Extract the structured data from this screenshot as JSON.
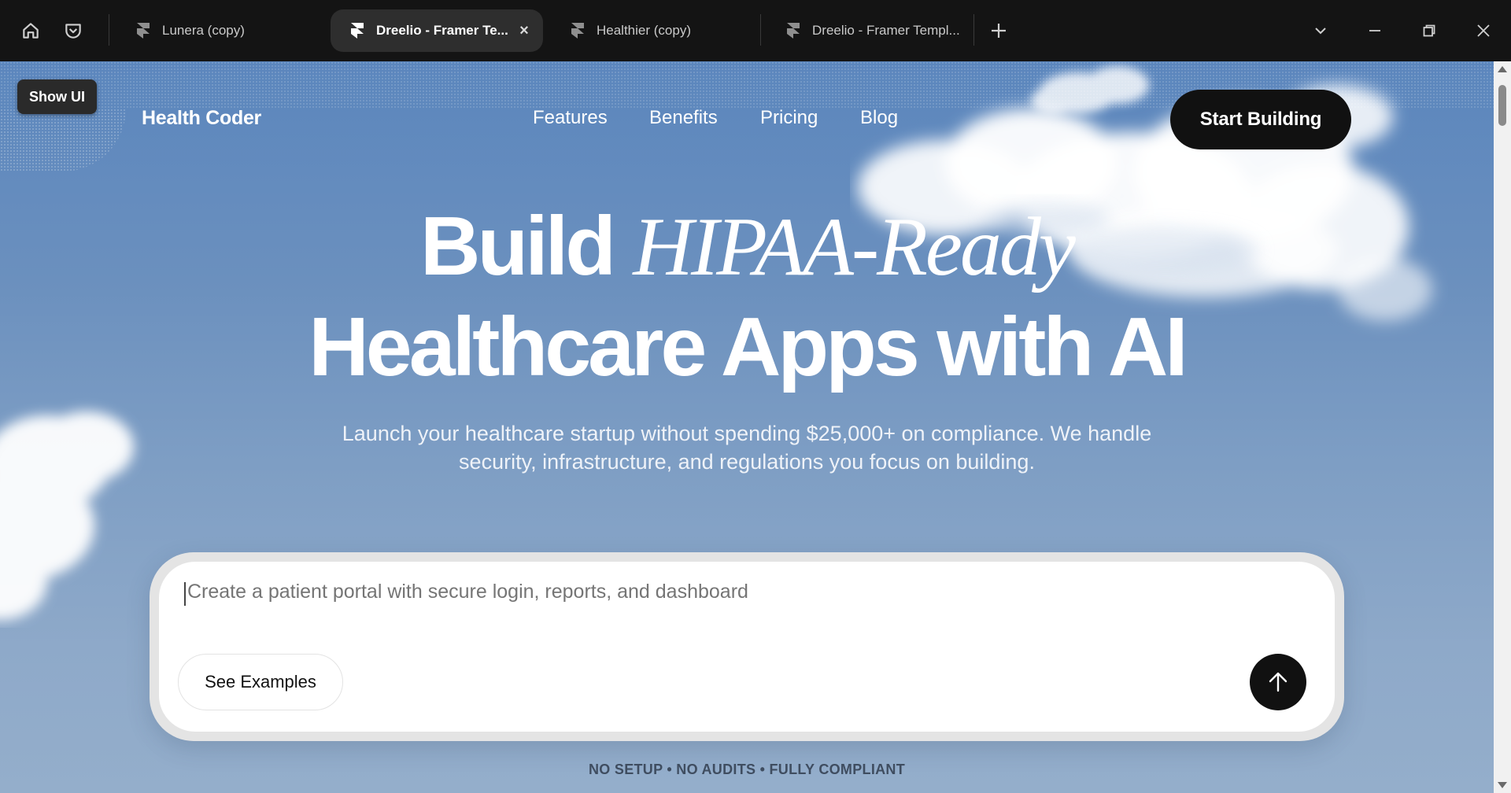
{
  "browser": {
    "tabs": [
      {
        "label": "Lunera (copy)",
        "active": false
      },
      {
        "label": "Dreelio - Framer Te...",
        "active": true
      },
      {
        "label": "Healthier (copy)",
        "active": false
      },
      {
        "label": "Dreelio - Framer Templ...",
        "active": false
      }
    ],
    "close_glyph": "×",
    "new_tab_glyph": "+"
  },
  "page": {
    "show_ui_label": "Show UI",
    "brand": "Health Coder",
    "nav": [
      "Features",
      "Benefits",
      "Pricing",
      "Blog"
    ],
    "cta_label": "Start Building",
    "headline": {
      "line1_plain": "Build",
      "line1_italic": "HIPAA-Ready",
      "line2": "Healthcare Apps with AI"
    },
    "subheadline": "Launch your healthcare startup without spending $25,000+ on compliance. We handle security, infrastructure, and regulations you focus on building.",
    "composer": {
      "placeholder": "Create a patient portal with secure login, reports, and dashboard",
      "examples_label": "See Examples",
      "send_icon": "arrow-up-icon"
    },
    "tagline": "NO SETUP • NO AUDITS • FULLY COMPLIANT"
  },
  "colors": {
    "sky_top": "#5b86bd",
    "sky_bottom": "#94aecb",
    "cta_bg": "#111111",
    "chrome_bg": "#141414"
  }
}
